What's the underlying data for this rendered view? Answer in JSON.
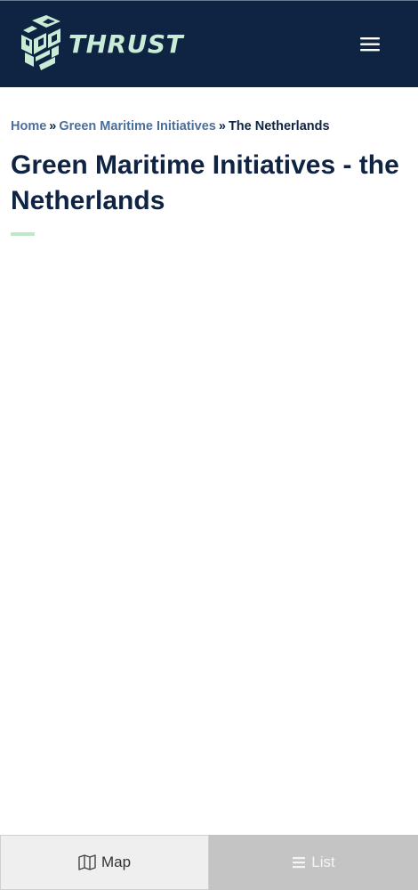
{
  "header": {
    "brand_name": "THRUST",
    "logo_icon": "thrust-cube-logo",
    "menu_icon": "hamburger-menu-icon",
    "background_color": "#0f2342",
    "brand_color": "#c8ecd6"
  },
  "breadcrumb": {
    "items": [
      {
        "label": "Home"
      },
      {
        "label": "Green Maritime Initiatives"
      },
      {
        "label": "The Netherlands"
      }
    ],
    "separator": "»"
  },
  "page": {
    "title": "Green Maritime Initiatives - the Netherlands",
    "accent_color": "#bfe8c9"
  },
  "bottom_bar": {
    "map_label": "Map",
    "map_icon": "map-icon",
    "list_label": "List",
    "list_icon": "list-icon"
  }
}
